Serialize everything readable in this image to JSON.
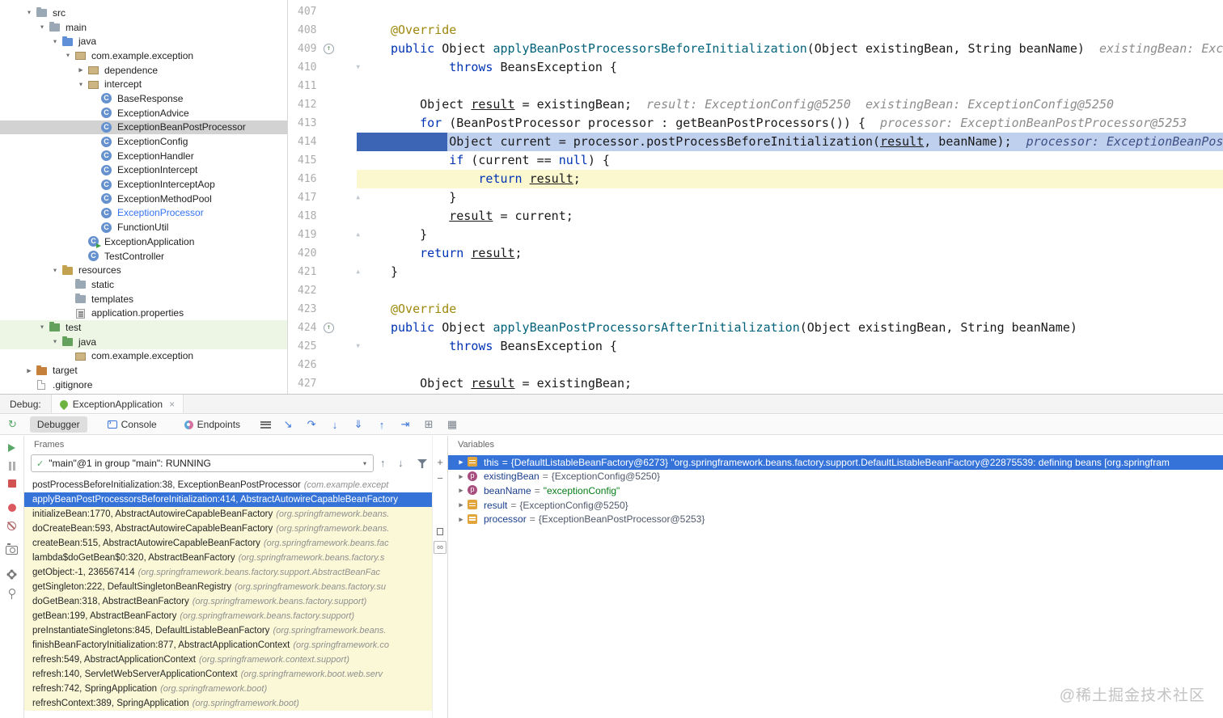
{
  "watermark": "@稀土掘金技术社区",
  "tree": {
    "items": [
      {
        "label": "src",
        "indent": 1,
        "chevron": "down",
        "icon": "folder"
      },
      {
        "label": "main",
        "indent": 2,
        "chevron": "down",
        "icon": "folder"
      },
      {
        "label": "java",
        "indent": 3,
        "chevron": "down",
        "icon": "folder-src"
      },
      {
        "label": "com.example.exception",
        "indent": 4,
        "chevron": "down",
        "icon": "package"
      },
      {
        "label": "dependence",
        "indent": 5,
        "chevron": "right",
        "icon": "package"
      },
      {
        "label": "intercept",
        "indent": 5,
        "chevron": "down",
        "icon": "package"
      },
      {
        "label": "BaseResponse",
        "indent": 6,
        "icon": "class"
      },
      {
        "label": "ExceptionAdvice",
        "indent": 6,
        "icon": "class"
      },
      {
        "label": "ExceptionBeanPostProcessor",
        "indent": 6,
        "icon": "class",
        "selected": true
      },
      {
        "label": "ExceptionConfig",
        "indent": 6,
        "icon": "class"
      },
      {
        "label": "ExceptionHandler",
        "indent": 6,
        "icon": "class"
      },
      {
        "label": "ExceptionIntercept",
        "indent": 6,
        "icon": "class"
      },
      {
        "label": "ExceptionInterceptAop",
        "indent": 6,
        "icon": "class"
      },
      {
        "label": "ExceptionMethodPool",
        "indent": 6,
        "icon": "class"
      },
      {
        "label": "ExceptionProcessor",
        "indent": 6,
        "icon": "class",
        "modified": true
      },
      {
        "label": "FunctionUtil",
        "indent": 6,
        "icon": "class"
      },
      {
        "label": "ExceptionApplication",
        "indent": 5,
        "icon": "class-run"
      },
      {
        "label": "TestController",
        "indent": 5,
        "icon": "class"
      },
      {
        "label": "resources",
        "indent": 3,
        "chevron": "down",
        "icon": "folder-res"
      },
      {
        "label": "static",
        "indent": 4,
        "icon": "folder"
      },
      {
        "label": "templates",
        "indent": 4,
        "icon": "folder"
      },
      {
        "label": "application.properties",
        "indent": 4,
        "icon": "props"
      },
      {
        "label": "test",
        "indent": 2,
        "chevron": "down",
        "icon": "folder-test",
        "test": true
      },
      {
        "label": "java",
        "indent": 3,
        "chevron": "down",
        "icon": "folder-test",
        "test": true
      },
      {
        "label": "com.example.exception",
        "indent": 4,
        "icon": "package"
      },
      {
        "label": "target",
        "indent": 1,
        "chevron": "right",
        "icon": "folder-target"
      },
      {
        "label": ".gitignore",
        "indent": 1,
        "icon": "file"
      }
    ]
  },
  "editor": {
    "lines": [
      {
        "num": "407",
        "segs": []
      },
      {
        "num": "408",
        "segs": [
          [
            "ann",
            "@Override"
          ]
        ]
      },
      {
        "num": "409",
        "gutter": "override",
        "segs": [
          [
            "kw",
            "public"
          ],
          [
            "pl",
            " Object "
          ],
          [
            "fn",
            "applyBeanPostProcessorsBeforeInitialization"
          ],
          [
            "pl",
            "(Object existingBean, String beanName)"
          ]
        ],
        "hint": "existingBean: Exc"
      },
      {
        "num": "410",
        "fold": "down",
        "segs": [
          [
            "pl",
            "        "
          ],
          [
            "kw",
            "throws"
          ],
          [
            "pl",
            " BeansException {"
          ]
        ]
      },
      {
        "num": "411",
        "segs": []
      },
      {
        "num": "412",
        "segs": [
          [
            "pl",
            "    Object "
          ],
          [
            "un",
            "result"
          ],
          [
            "pl",
            " = existingBean;"
          ]
        ],
        "hint": "result: ExceptionConfig@5250  existingBean: ExceptionConfig@5250"
      },
      {
        "num": "413",
        "segs": [
          [
            "pl",
            "    "
          ],
          [
            "kw",
            "for"
          ],
          [
            "pl",
            " (BeanPostProcessor processor : getBeanPostProcessors()) {"
          ]
        ],
        "hint": "processor: ExceptionBeanPostProcessor@5253"
      },
      {
        "num": "414",
        "cls": "exec",
        "segs": [
          [
            "pl",
            "        Object current = processor.postProcessBeforeInitialization("
          ],
          [
            "un",
            "result"
          ],
          [
            "pl",
            ", beanName);"
          ]
        ],
        "hint": "processor: ExceptionBeanPos"
      },
      {
        "num": "415",
        "segs": [
          [
            "pl",
            "        "
          ],
          [
            "kw",
            "if"
          ],
          [
            "pl",
            " (current == "
          ],
          [
            "kw",
            "null"
          ],
          [
            "pl",
            ") {"
          ]
        ]
      },
      {
        "num": "416",
        "cls": "soft",
        "segs": [
          [
            "pl",
            "            "
          ],
          [
            "kw",
            "return"
          ],
          [
            "pl",
            " "
          ],
          [
            "un",
            "result"
          ],
          [
            "pl",
            ";"
          ]
        ]
      },
      {
        "num": "417",
        "fold": "up",
        "segs": [
          [
            "pl",
            "        }"
          ]
        ]
      },
      {
        "num": "418",
        "segs": [
          [
            "pl",
            "        "
          ],
          [
            "un",
            "result"
          ],
          [
            "pl",
            " = current;"
          ]
        ]
      },
      {
        "num": "419",
        "fold": "up",
        "segs": [
          [
            "pl",
            "    }"
          ]
        ]
      },
      {
        "num": "420",
        "segs": [
          [
            "pl",
            "    "
          ],
          [
            "kw",
            "return"
          ],
          [
            "pl",
            " "
          ],
          [
            "un",
            "result"
          ],
          [
            "pl",
            ";"
          ]
        ]
      },
      {
        "num": "421",
        "fold": "up",
        "segs": [
          [
            "pl",
            "}"
          ]
        ]
      },
      {
        "num": "422",
        "segs": []
      },
      {
        "num": "423",
        "segs": [
          [
            "ann",
            "@Override"
          ]
        ]
      },
      {
        "num": "424",
        "gutter": "override",
        "segs": [
          [
            "kw",
            "public"
          ],
          [
            "pl",
            " Object "
          ],
          [
            "fn",
            "applyBeanPostProcessorsAfterInitialization"
          ],
          [
            "pl",
            "(Object existingBean, String beanName)"
          ]
        ]
      },
      {
        "num": "425",
        "fold": "down",
        "segs": [
          [
            "pl",
            "        "
          ],
          [
            "kw",
            "throws"
          ],
          [
            "pl",
            " BeansException {"
          ]
        ]
      },
      {
        "num": "426",
        "segs": []
      },
      {
        "num": "427",
        "segs": [
          [
            "pl",
            "    Object "
          ],
          [
            "un",
            "result"
          ],
          [
            "pl",
            " = existingBean;"
          ]
        ]
      }
    ]
  },
  "debug": {
    "label": "Debug:",
    "session": {
      "name": "ExceptionApplication",
      "close": "×"
    },
    "tabs": [
      {
        "label": "Debugger",
        "selected": true
      },
      {
        "label": "Console",
        "icon": "console-icon"
      },
      {
        "label": "Endpoints",
        "icon": "endpoints-icon"
      }
    ],
    "toolbar": [
      {
        "name": "show-execution-point-icon",
        "glyph": "↘"
      },
      {
        "name": "step-over-icon",
        "glyph": "↷"
      },
      {
        "name": "step-into-icon",
        "glyph": "↓"
      },
      {
        "name": "force-step-into-icon",
        "glyph": "⇓"
      },
      {
        "name": "step-out-icon",
        "glyph": "↑"
      },
      {
        "name": "run-to-cursor-icon",
        "glyph": "⇥"
      },
      {
        "name": "layout-settings-icon",
        "glyph": "⊞",
        "gray": true
      },
      {
        "name": "restore-layout-icon",
        "glyph": "▦",
        "gray": true
      }
    ],
    "left_toolbar": [
      {
        "name": "resume-icon",
        "type": "play"
      },
      {
        "name": "pause-icon",
        "type": "pause"
      },
      {
        "name": "stop-icon",
        "type": "stop"
      },
      {
        "name": "view-breakpoints-icon",
        "type": "bp",
        "gap": true
      },
      {
        "name": "mute-breakpoints-icon",
        "type": "mute"
      },
      {
        "name": "thread-dump-camera-icon",
        "type": "camera",
        "gap": true
      },
      {
        "name": "settings-gear-icon",
        "type": "gear",
        "gap": true
      },
      {
        "name": "pin-icon",
        "type": "pin"
      }
    ],
    "watch_strip": [
      {
        "name": "add-watch-icon",
        "glyph": "+"
      },
      {
        "name": "remove-watch-icon",
        "glyph": "−"
      },
      {
        "name": "copy-stack-icon",
        "type": "copy",
        "gap": true
      },
      {
        "name": "evaluate-icon",
        "glyph": "∞",
        "boxed": true
      }
    ],
    "frames": {
      "title": "Frames",
      "thread": "\"main\"@1 in group \"main\": RUNNING",
      "rows": [
        {
          "text": "postProcessBeforeInitialization:38, ExceptionBeanPostProcessor",
          "pkg": "(com.example.except",
          "kind": "user"
        },
        {
          "text": "applyBeanPostProcessorsBeforeInitialization:414, AbstractAutowireCapableBeanFactory",
          "pkg": "",
          "kind": "sel"
        },
        {
          "text": "initializeBean:1770, AbstractAutowireCapableBeanFactory",
          "pkg": "(org.springframework.beans.",
          "kind": "lib"
        },
        {
          "text": "doCreateBean:593, AbstractAutowireCapableBeanFactory",
          "pkg": "(org.springframework.beans.",
          "kind": "lib"
        },
        {
          "text": "createBean:515, AbstractAutowireCapableBeanFactory",
          "pkg": "(org.springframework.beans.fac",
          "kind": "lib"
        },
        {
          "text": "lambda$doGetBean$0:320, AbstractBeanFactory",
          "pkg": "(org.springframework.beans.factory.s",
          "kind": "lib"
        },
        {
          "text": "getObject:-1, 236567414",
          "pkg": "(org.springframework.beans.factory.support.AbstractBeanFac",
          "kind": "lib"
        },
        {
          "text": "getSingleton:222, DefaultSingletonBeanRegistry",
          "pkg": "(org.springframework.beans.factory.su",
          "kind": "lib"
        },
        {
          "text": "doGetBean:318, AbstractBeanFactory",
          "pkg": "(org.springframework.beans.factory.support)",
          "kind": "lib"
        },
        {
          "text": "getBean:199, AbstractBeanFactory",
          "pkg": "(org.springframework.beans.factory.support)",
          "kind": "lib"
        },
        {
          "text": "preInstantiateSingletons:845, DefaultListableBeanFactory",
          "pkg": "(org.springframework.beans.",
          "kind": "lib"
        },
        {
          "text": "finishBeanFactoryInitialization:877, AbstractApplicationContext",
          "pkg": "(org.springframework.co",
          "kind": "lib"
        },
        {
          "text": "refresh:549, AbstractApplicationContext",
          "pkg": "(org.springframework.context.support)",
          "kind": "lib"
        },
        {
          "text": "refresh:140, ServletWebServerApplicationContext",
          "pkg": "(org.springframework.boot.web.serv",
          "kind": "lib"
        },
        {
          "text": "refresh:742, SpringApplication",
          "pkg": "(org.springframework.boot)",
          "kind": "lib"
        },
        {
          "text": "refreshContext:389, SpringApplication",
          "pkg": "(org.springframework.boot)",
          "kind": "lib"
        }
      ]
    },
    "variables": {
      "title": "Variables",
      "rows": [
        {
          "name": "this",
          "value": "{DefaultListableBeanFactory@6273} \"org.springframework.beans.factory.support.DefaultListableBeanFactory@22875539: defining beans [org.springfram",
          "icon": "local",
          "vkind": "obj",
          "selected": true
        },
        {
          "name": "existingBean",
          "value": "{ExceptionConfig@5250}",
          "icon": "param",
          "vkind": "obj"
        },
        {
          "name": "beanName",
          "value": "\"exceptionConfig\"",
          "icon": "param",
          "vkind": "str"
        },
        {
          "name": "result",
          "value": "{ExceptionConfig@5250}",
          "icon": "local",
          "vkind": "obj"
        },
        {
          "name": "processor",
          "value": "{ExceptionBeanPostProcessor@5253}",
          "icon": "local",
          "vkind": "obj"
        }
      ]
    }
  }
}
